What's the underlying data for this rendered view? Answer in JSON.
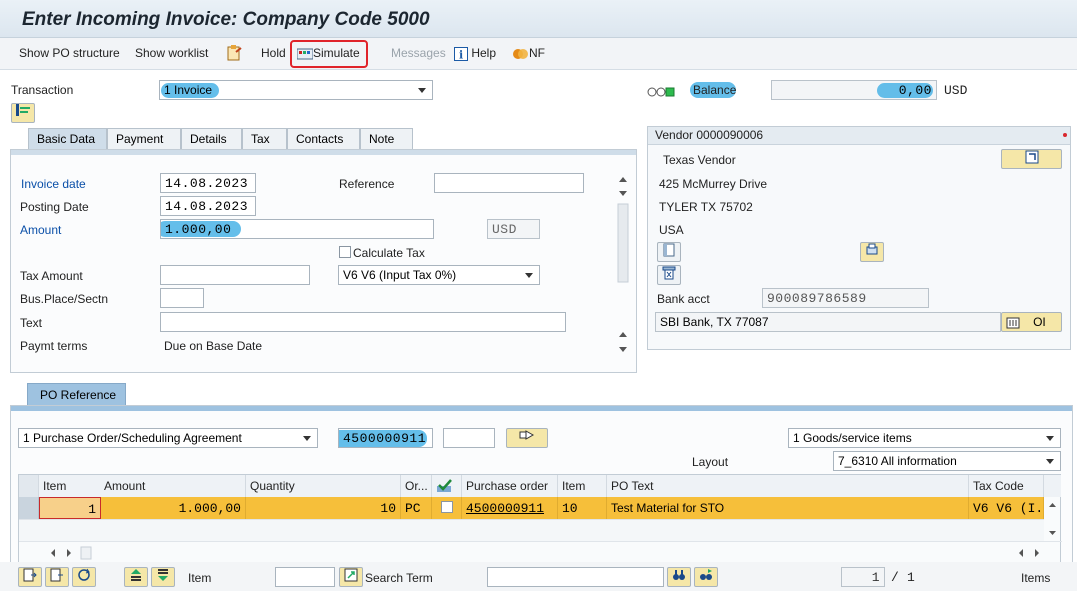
{
  "window": {
    "title": "Enter Incoming Invoice: Company Code 5000"
  },
  "toolbar": {
    "show_po_structure": "Show PO structure",
    "show_worklist": "Show worklist",
    "hold": "Hold",
    "simulate": "Simulate",
    "messages": "Messages",
    "help": "Help",
    "nf": "NF"
  },
  "header": {
    "transaction_label": "Transaction",
    "transaction_value": "1 Invoice",
    "balance_label": "Balance",
    "balance_value": "0,00",
    "balance_currency": "USD"
  },
  "tabs": [
    "Basic Data",
    "Payment",
    "Details",
    "Tax",
    "Contacts",
    "Note"
  ],
  "basic_data": {
    "invoice_date_label": "Invoice date",
    "invoice_date": "14.08.2023",
    "reference_label": "Reference",
    "reference": "",
    "posting_date_label": "Posting Date",
    "posting_date": "14.08.2023",
    "amount_label": "Amount",
    "amount": "1.000,00",
    "currency": "USD",
    "calculate_tax_label": "Calculate Tax",
    "tax_amount_label": "Tax Amount",
    "tax_code": "V6 V6 (Input Tax 0%)",
    "bus_place_label": "Bus.Place/Sectn",
    "text_label": "Text",
    "paymt_terms_label": "Paymt terms",
    "paymt_terms_value": "Due on Base Date"
  },
  "vendor": {
    "header": "Vendor 0000090006",
    "name": "Texas Vendor",
    "street": "425 McMurrey Drive",
    "city": "TYLER TX  75702",
    "country": "USA",
    "bank_acct_label": "Bank acct",
    "bank_acct": "900089786589",
    "bank_name": "SBI Bank, TX 77087",
    "oi_button": "OI"
  },
  "po_reference": {
    "tab": "PO Reference",
    "ref_type": "1 Purchase Order/Scheduling Agreement",
    "po_number": "4500000911",
    "item_field": "",
    "items_type": "1 Goods/service items",
    "layout_label": "Layout",
    "layout_value": "7_6310 All information"
  },
  "grid": {
    "columns": [
      "Item",
      "Amount",
      "Quantity",
      "Or...",
      "",
      "Purchase order",
      "Item",
      "PO Text",
      "Tax Code"
    ],
    "rows": [
      {
        "item": "1",
        "amount": "1.000,00",
        "quantity": "10",
        "order_unit": "PC",
        "purchase_order": "4500000911",
        "po_item": "10",
        "po_text": "Test Material for STO",
        "tax_code": "V6 V6 (I..."
      }
    ]
  },
  "bottom": {
    "item_label": "Item",
    "search_term_label": "Search Term",
    "page_current": "1",
    "page_separator": "/",
    "page_total": "1",
    "items_label": "Items"
  }
}
